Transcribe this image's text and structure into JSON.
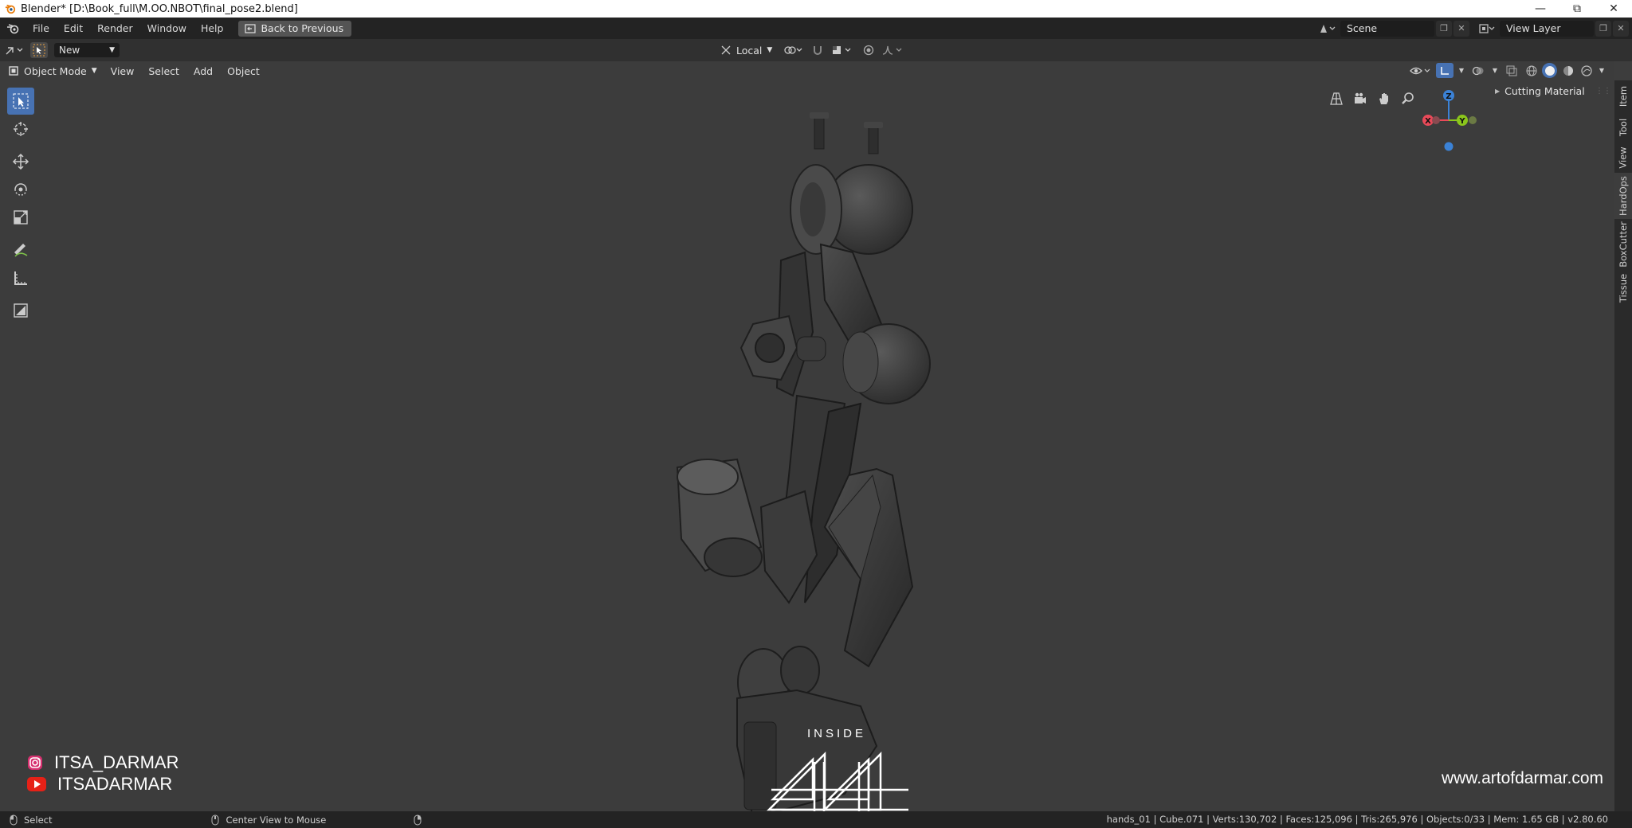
{
  "window": {
    "title": "Blender* [D:\\Book_full\\M.OO.NBOT\\final_pose2.blend]",
    "minimize_icon": "minimize-icon",
    "restore_icon": "restore-icon",
    "close_icon": "close-icon"
  },
  "topbar": {
    "menus": [
      "File",
      "Edit",
      "Render",
      "Window",
      "Help"
    ],
    "back_button_label": "Back to Previous",
    "scene_name": "Scene",
    "view_layer_name": "View Layer"
  },
  "toolheader": {
    "brush_dropdown": "New",
    "orientation": "Local"
  },
  "viewport_header": {
    "mode": "Object Mode",
    "menus": [
      "View",
      "Select",
      "Add",
      "Object"
    ]
  },
  "gizmo": {
    "x_label": "X",
    "y_label": "Y",
    "z_label": "Z",
    "colors": {
      "x": "#e94a59",
      "y": "#8bc61c",
      "z": "#3b82d6"
    }
  },
  "npanel": {
    "panel_title": "Cutting Material"
  },
  "sidetabs": [
    "Item",
    "Tool",
    "View",
    "HardOps",
    "BoxCutter",
    "Tissue"
  ],
  "overlay": {
    "instagram": "ITSA_DARMAR",
    "youtube": "ITSADARMAR",
    "website": "www.artofdarmar.com",
    "logo_top": "INSIDE"
  },
  "statusbar": {
    "left_action": "Select",
    "middle_action": "Center View to Mouse",
    "stats": "hands_01 | Cube.071 | Verts:130,702 | Faces:125,096 | Tris:265,976 | Objects:0/33 | Mem: 1.65 GB | v2.80.60"
  },
  "colors": {
    "accent": "#4772b3",
    "viewport_bg": "#3c3c3c",
    "header_bg": "#232323"
  }
}
